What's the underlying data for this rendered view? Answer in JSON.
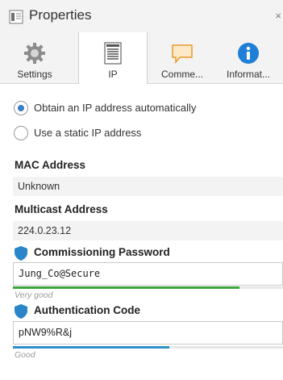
{
  "window": {
    "title": "Properties",
    "close_glyph": "×"
  },
  "tabs": [
    {
      "label": "Settings",
      "icon": "gear-icon",
      "active": false
    },
    {
      "label": "IP",
      "icon": "ip-document-icon",
      "active": true
    },
    {
      "label": "Comme...",
      "icon": "comment-icon",
      "active": false
    },
    {
      "label": "Informat...",
      "icon": "info-icon",
      "active": false
    }
  ],
  "ip": {
    "radio_auto_label": "Obtain an IP address automatically",
    "radio_auto_checked": true,
    "radio_static_label": "Use a static IP address",
    "radio_static_checked": false,
    "mac_label": "MAC Address",
    "mac_value": "Unknown",
    "multicast_label": "Multicast Address",
    "multicast_value": "224.0.23.12"
  },
  "commissioning": {
    "label": "Commissioning Password",
    "value": "Jung_Co@Secure",
    "strength_text": "Very good",
    "strength_fraction": 0.84,
    "strength_color": "#3aa53a"
  },
  "authentication": {
    "label": "Authentication Code",
    "value": "pNW9%R&j",
    "strength_text": "Good",
    "strength_fraction": 0.58,
    "strength_color": "#2b8fc9"
  },
  "colors": {
    "accent_blue": "#3b7fc4",
    "shield_blue": "#2a86c8"
  }
}
